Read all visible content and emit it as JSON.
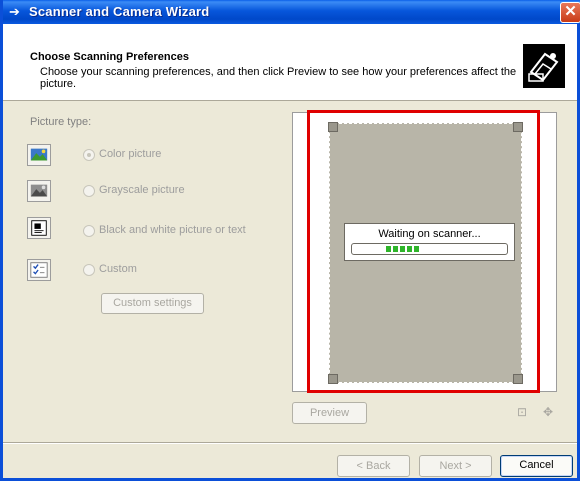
{
  "window": {
    "title": "Scanner and Camera Wizard"
  },
  "header": {
    "title": "Choose Scanning Preferences",
    "description": "Choose your scanning preferences, and then click Preview to see how your preferences affect the picture."
  },
  "picture_type": {
    "label": "Picture type:",
    "options": [
      {
        "label": "Color picture",
        "selected": true,
        "icon": "color-picture-icon"
      },
      {
        "label": "Grayscale picture",
        "selected": false,
        "icon": "grayscale-picture-icon"
      },
      {
        "label": "Black and white picture or text",
        "selected": false,
        "icon": "black-white-text-icon"
      },
      {
        "label": "Custom",
        "selected": false,
        "icon": "custom-settings-icon"
      }
    ],
    "custom_settings_label": "Custom settings"
  },
  "preview": {
    "status_text": "Waiting on scanner...",
    "progress_segments": 5,
    "button_label": "Preview"
  },
  "footer": {
    "back_label": "< Back",
    "next_label": "Next >",
    "cancel_label": "Cancel"
  },
  "colors": {
    "titlebar": "#0756db",
    "highlight_frame": "#e00000",
    "progress": "#2fb52a"
  }
}
